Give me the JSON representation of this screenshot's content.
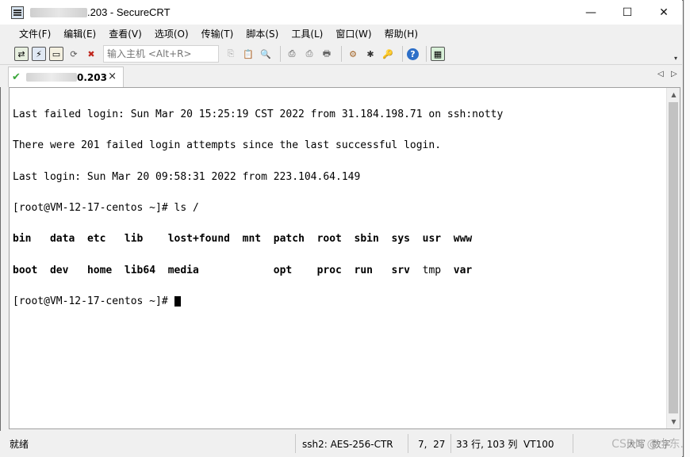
{
  "window": {
    "title_suffix": ".203 - SecureCRT",
    "controls": {
      "minimize": "—",
      "maximize": "☐",
      "close": "✕"
    }
  },
  "menu": [
    "文件(F)",
    "编辑(E)",
    "查看(V)",
    "选项(O)",
    "传输(T)",
    "脚本(S)",
    "工具(L)",
    "窗口(W)",
    "帮助(H)"
  ],
  "toolbar": {
    "quick_connect_placeholder": "输入主机 <Alt+R>"
  },
  "tab": {
    "label": "0.203",
    "close": "×"
  },
  "terminal": {
    "lines": [
      "Last failed login: Sun Mar 20 15:25:19 CST 2022 from 31.184.198.71 on ssh:notty",
      "There were 201 failed login attempts since the last successful login.",
      "Last login: Sun Mar 20 09:58:31 2022 from 223.104.64.149",
      "[root@VM-12-17-centos ~]# ls /"
    ],
    "ls_row1": [
      "bin",
      "data",
      "etc",
      "lib",
      "lost+found",
      "mnt",
      "patch",
      "root",
      "sbin",
      "sys",
      "usr",
      "www"
    ],
    "ls_row2": [
      "boot",
      "dev",
      "home",
      "lib64",
      "media",
      "",
      "opt",
      "proc",
      "run",
      "srv",
      "tmp",
      "var"
    ],
    "prompt": "[root@VM-12-17-centos ~]# "
  },
  "status": {
    "ready": "就绪",
    "protocol": "ssh2: AES-256-CTR",
    "cursor_pos": "7,  27",
    "size": "33 行, 103 列  VT100",
    "caps": "大写  数字"
  },
  "watermark": "CSDN @小东."
}
